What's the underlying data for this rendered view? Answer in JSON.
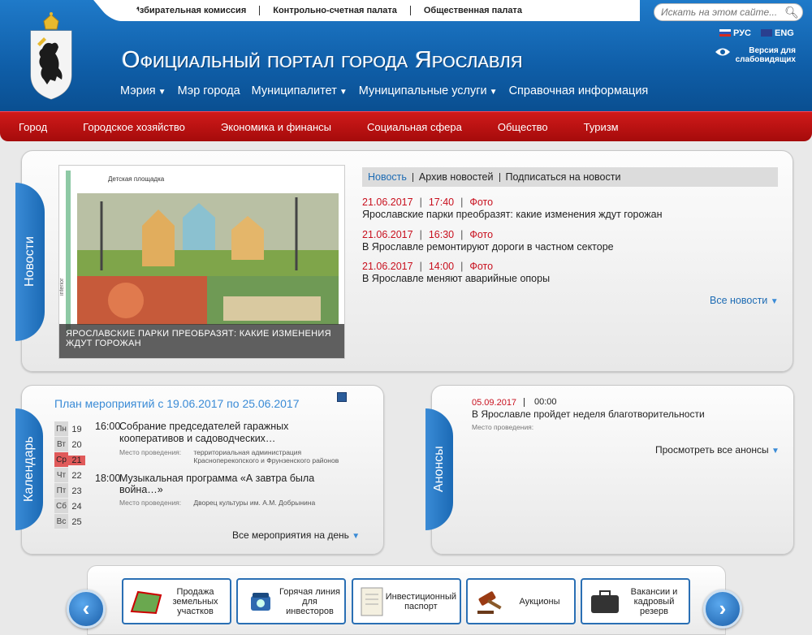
{
  "topbar": {
    "links": [
      "Избирательная комиссия",
      "Контрольно-счетная палата",
      "Общественная палата"
    ],
    "search_placeholder": "Искать на этом сайте..."
  },
  "header": {
    "title": "Официальный портал города Ярославля",
    "lang_ru": "РУС",
    "lang_en": "ENG",
    "low_vision": "Версия для слабовидящих",
    "nav": [
      "Мэрия",
      "Мэр города",
      "Муниципалитет",
      "Муниципальные услуги",
      "Справочная информация"
    ]
  },
  "rednav": [
    "Город",
    "Городское хозяйство",
    "Экономика и финансы",
    "Социальная сфера",
    "Общество",
    "Туризм"
  ],
  "news": {
    "tab": "Новости",
    "photo_label": "Детская площадка",
    "photo_side": "interior",
    "caption": "ЯРОСЛАВСКИЕ ПАРКИ ПРЕОБРАЗЯТ: КАКИЕ ИЗМЕНЕНИЯ ЖДУТ ГОРОЖАН",
    "bar": [
      "Новость",
      "Архив новостей",
      "Подписаться на новости"
    ],
    "items": [
      {
        "date": "21.06.2017",
        "time": "17:40",
        "type": "Фото",
        "title": "Ярославские парки преобразят: какие изменения ждут горожан"
      },
      {
        "date": "21.06.2017",
        "time": "16:30",
        "type": "Фото",
        "title": "В Ярославле ремонтируют дороги в частном секторе"
      },
      {
        "date": "21.06.2017",
        "time": "14:00",
        "type": "Фото",
        "title": "В Ярославле меняют аварийные опоры"
      }
    ],
    "all": "Все новости"
  },
  "calendar": {
    "tab": "Календарь",
    "title": "План мероприятий с 19.06.2017 по 25.06.2017",
    "days": [
      {
        "n": "Пн",
        "d": "19"
      },
      {
        "n": "Вт",
        "d": "20"
      },
      {
        "n": "Ср",
        "d": "21"
      },
      {
        "n": "Чт",
        "d": "22"
      },
      {
        "n": "Пт",
        "d": "23"
      },
      {
        "n": "Сб",
        "d": "24"
      },
      {
        "n": "Вс",
        "d": "25"
      }
    ],
    "active_day": 2,
    "events": [
      {
        "time": "16:00",
        "title": "Собрание председателей гаражных кооперативов и садоводческих…",
        "place_label": "Место проведения:",
        "place": "территориальная администрация Красноперекопского и Фрунзенского районов"
      },
      {
        "time": "18:00",
        "title": "Музыкальная программа «А завтра была война…»",
        "place_label": "Место проведения:",
        "place": "Дворец культуры им. А.М. Добрынина"
      }
    ],
    "all": "Все мероприятия на день"
  },
  "announcements": {
    "tab": "Анонсы",
    "date": "05.09.2017",
    "time": "00:00",
    "title": "В Ярославле пройдет неделя благотворительности",
    "place_label": "Место проведения:",
    "all": "Просмотреть все анонсы"
  },
  "tiles": [
    {
      "label": "Продажа земельных участков",
      "icon": "land-plot-icon"
    },
    {
      "label": "Горячая линия для инвесторов",
      "icon": "phone-icon"
    },
    {
      "label": "Инвестиционный паспорт",
      "icon": "certificate-icon"
    },
    {
      "label": "Аукционы",
      "icon": "gavel-icon"
    },
    {
      "label": "Вакансии и кадровый резерв",
      "icon": "briefcase-icon"
    }
  ],
  "colors": {
    "brand_blue": "#0f5ea8",
    "brand_red": "#c8101e",
    "link": "#1e6cb4"
  }
}
